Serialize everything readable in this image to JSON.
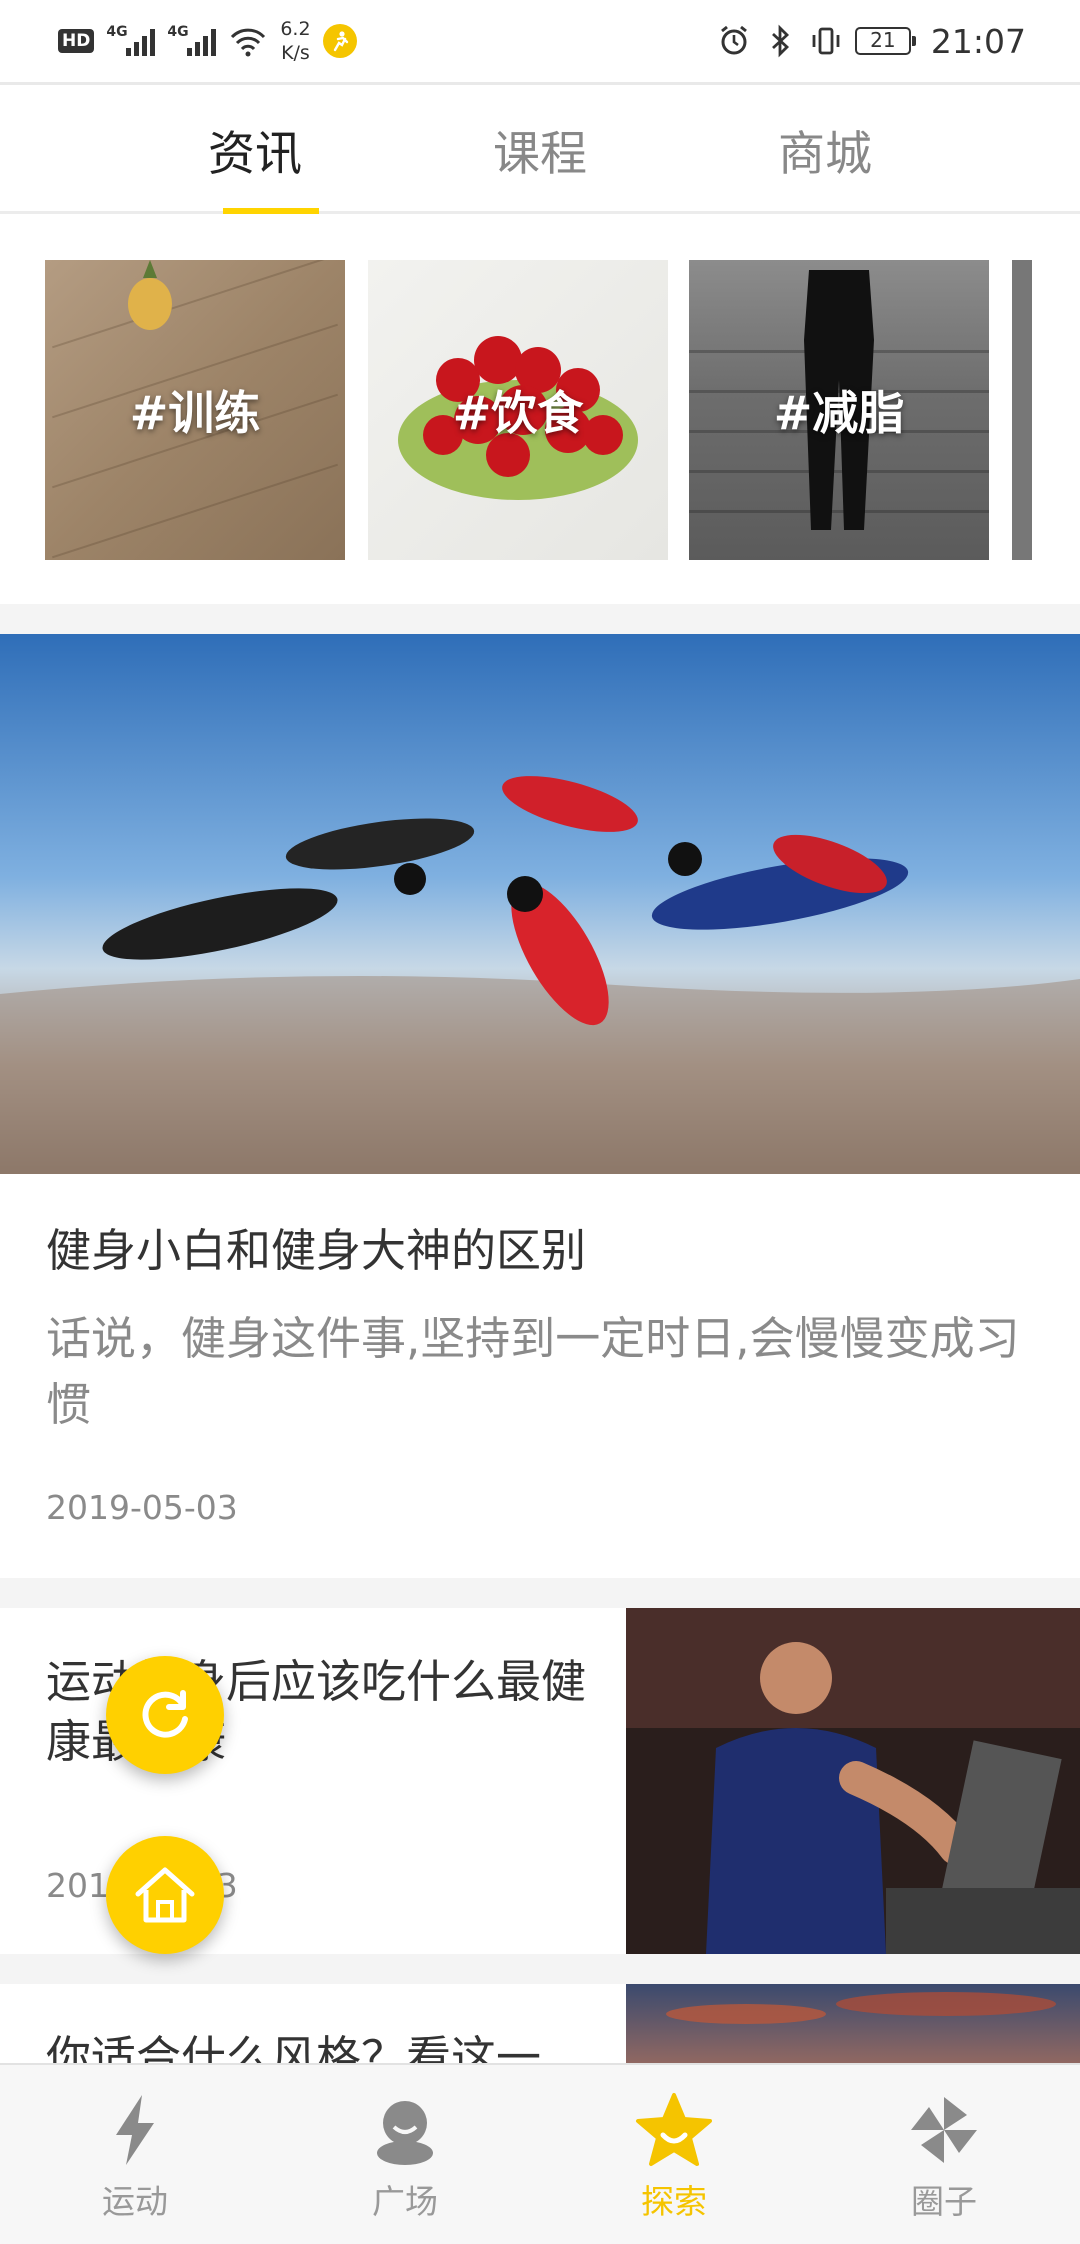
{
  "status_bar": {
    "hd": "HD",
    "net1": "4G",
    "net2": "4G",
    "speed_value": "6.2",
    "speed_unit": "K/s",
    "battery": "21",
    "time": "21:07"
  },
  "tabs": [
    {
      "label": "资讯",
      "active": true
    },
    {
      "label": "课程",
      "active": false
    },
    {
      "label": "商城",
      "active": false
    }
  ],
  "categories": [
    {
      "label": "#训练",
      "icon": "training-photo"
    },
    {
      "label": "#饮食",
      "icon": "cherries-photo"
    },
    {
      "label": "#减脂",
      "icon": "leggings-photo"
    }
  ],
  "featured": {
    "title": "健身小白和健身大神的区别",
    "description": "话说，健身这件事,坚持到一定时日,会慢慢变成习惯",
    "date": "2019-05-03"
  },
  "articles": [
    {
      "title": "运动健身后应该吃什么最健康最健康",
      "date": "2019-05-03"
    },
    {
      "title": "你适合什么风格？看这一"
    }
  ],
  "bottom_nav": [
    {
      "label": "运动",
      "icon": "lightning-icon",
      "active": false
    },
    {
      "label": "广场",
      "icon": "community-icon",
      "active": false
    },
    {
      "label": "探索",
      "icon": "star-icon",
      "active": true
    },
    {
      "label": "圈子",
      "icon": "pinwheel-icon",
      "active": false
    }
  ],
  "colors": {
    "accent": "#ffd400",
    "active_nav": "#f5c400",
    "text_primary": "#333333",
    "text_secondary": "#8a8a8a"
  }
}
